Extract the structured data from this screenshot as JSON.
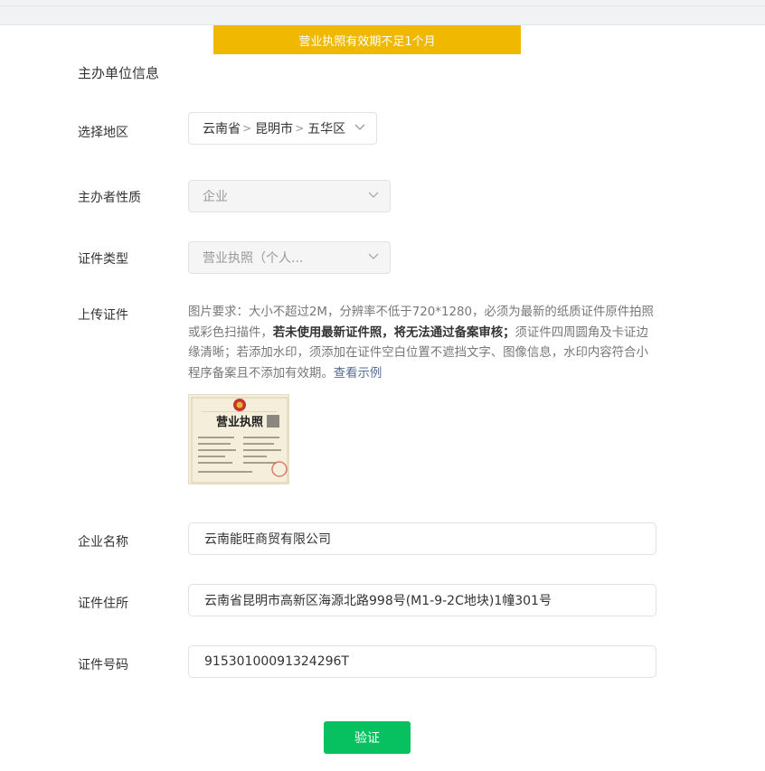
{
  "banner": {
    "warning": "营业执照有效期不足1个月"
  },
  "section": {
    "title": "主办单位信息"
  },
  "region": {
    "label": "选择地区",
    "province": "云南省",
    "city": "昆明市",
    "district": "五华区"
  },
  "nature": {
    "label": "主办者性质",
    "value": "企业"
  },
  "cert_type": {
    "label": "证件类型",
    "value": "营业执照（个人..."
  },
  "upload": {
    "label": "上传证件",
    "desc_1": "图片要求：大小不超过2M，分辨率不低于720*1280，必须为最新的纸质证件原件拍照或彩色扫描件，",
    "desc_bold": "若未使用最新证件照，将无法通过备案审核；",
    "desc_2": "须证件四周圆角及卡证边缘清晰；若添加水印，须添加在证件空白位置不遮挡文字、图像信息，水印内容符合小程序备案且不添加有效期。",
    "example_link": "查看示例",
    "thumb_title": "营业执照"
  },
  "company": {
    "label": "企业名称",
    "value": "云南能旺商贸有限公司"
  },
  "address": {
    "label": "证件住所",
    "value": "云南省昆明市高新区海源北路998号(M1-9-2C地块)1幢301号"
  },
  "cert_no": {
    "label": "证件号码",
    "value": "91530100091324296T"
  },
  "submit": {
    "label": "验证"
  },
  "colors": {
    "warning": "#f0b800",
    "primary": "#07c160",
    "link": "#576b95"
  },
  "icons": {
    "select_arrow": "chevron-down-icon",
    "breadcrumb_sep": "chevron-right-icon",
    "emblem": "national-emblem-icon"
  }
}
